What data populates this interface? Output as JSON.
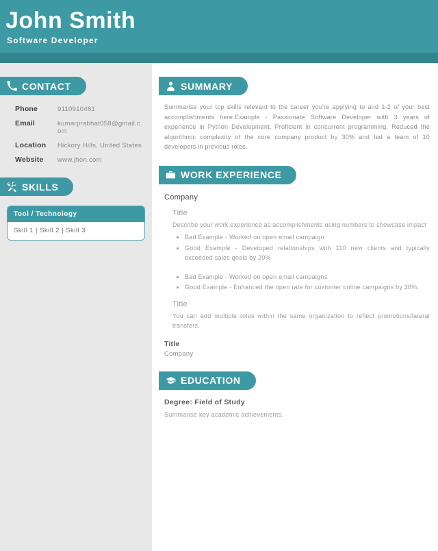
{
  "header": {
    "name": "John Smith",
    "role": "Software  Developer",
    "accent_color": "#3d9aa4",
    "band_color": "#33848c"
  },
  "sidebar": {
    "background_color": "#e8e8e8",
    "contact": {
      "heading": "CONTACT",
      "icon": "phone-icon",
      "rows": [
        {
          "label": "Phone",
          "value": "9110910481"
        },
        {
          "label": "Email",
          "value": "kumarprabhat058@gmail.com"
        },
        {
          "label": "Location",
          "value": "Hickory  Hills,  United  States"
        },
        {
          "label": "Website",
          "value": "www.jhon.com"
        }
      ]
    },
    "skills": {
      "heading": "SKILLS",
      "icon": "tools-icon",
      "table_header": "Tool  /  Technology",
      "table_row": "Skill  1  |   Skill  2  |   Skill  3"
    }
  },
  "main": {
    "summary": {
      "heading": "SUMMARY",
      "icon": "person-icon",
      "text": "Summarise your top skills relevant to the career you're applying to and 1-2 of your best accomplishments here.Example - Passionate Software Developer with 3 years of experience in Python Development. Proficient in concurrent programming. Reduced the algorithmic complexity of the core company product by 30% and led a team of 10 developers in previous roles."
    },
    "work": {
      "heading": "WORK  EXPERIENCE",
      "icon": "briefcase-icon",
      "company": "Company",
      "role1_title": "Title",
      "role1_desc": "Describe your work experience as accomplishments using numbers to showcase impact",
      "role1_bullets_group1": [
        "Bad  Example  -  Worked  on  open  email  campaign",
        "Good  Example  -  Developed  relationships  with  110  new  clients  and  typically  exceeded  sales  goals  by  20%"
      ],
      "role1_bullets_group2": [
        "Bad  Example  -  Worked  on  open  email  campaigns",
        "Good  Example  -  Enhanced  the  open  rate  for  customer  online  campaigns  by  28%."
      ],
      "role2_title": "Title",
      "role2_desc": "You can add multiple roles within the same organization to reflect promotions/lateral transfers.",
      "entry2_title": "Title",
      "entry2_company": "Company"
    },
    "education": {
      "heading": "EDUCATION",
      "icon": "graduation-cap-icon",
      "degree": "Degree:  Field  of  Study",
      "description": "Summarise  key  academic  achievements."
    }
  }
}
